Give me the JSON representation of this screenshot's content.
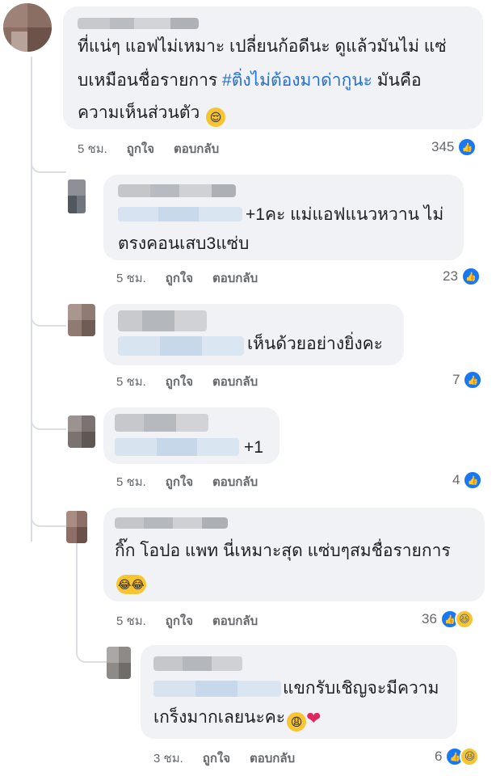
{
  "comments": [
    {
      "text_lines": [
        "ที่แน่ๆ แอฟไม่เหมาะ เปลี่ยนก้อดีนะ ดูแล้วมันไม่ แซ่",
        "บเหมือนชื่อรายการ ",
        "ความเห็นส่วนตัว"
      ],
      "hashtag": "#ติ่งไม่ต้องมาด่ากูนะ",
      "after_hashtag": " มันคือ",
      "emoji": "😌",
      "time": "5 ชม.",
      "like_label": "ถูกใจ",
      "reply_label": "ตอบกลับ",
      "reaction_count": "345"
    },
    {
      "text_lines": [
        "+1คะ แม่แอฟแนวหวาน ไม่",
        "ตรงคอนเสบ3แซ่บ"
      ],
      "time": "5 ชม.",
      "like_label": "ถูกใจ",
      "reply_label": "ตอบกลับ",
      "reaction_count": "23"
    },
    {
      "text_lines": [
        "เห็นด้วยอย่างยิ่งคะ"
      ],
      "time": "5 ชม.",
      "like_label": "ถูกใจ",
      "reply_label": "ตอบกลับ",
      "reaction_count": "7"
    },
    {
      "text_lines": [
        "+1"
      ],
      "time": "5 ชม.",
      "like_label": "ถูกใจ",
      "reply_label": "ตอบกลับ",
      "reaction_count": "4"
    },
    {
      "text_lines": [
        "กิ๊ก โอปอ แพท นี่เหมาะสุด แซ่บๆสมชื่อรายการ"
      ],
      "emoji": "😂😂",
      "time": "5 ชม.",
      "like_label": "ถูกใจ",
      "reply_label": "ตอบกลับ",
      "reaction_count": "36"
    },
    {
      "text_lines": [
        "แขกรับเชิญจะมีความ",
        "เกร็งมากเลยนะคะ"
      ],
      "emoji": "😩",
      "heart": "❤",
      "time": "3 ชม.",
      "like_label": "ถูกใจ",
      "reply_label": "ตอบกลับ",
      "reaction_count": "6"
    }
  ],
  "colors": {
    "bubble": "#f0f2f5",
    "meta": "#65676b",
    "hashtag": "#216fdb",
    "like": "#1877f2"
  },
  "icons": {
    "like": "like-icon",
    "haha": "haha-icon"
  }
}
